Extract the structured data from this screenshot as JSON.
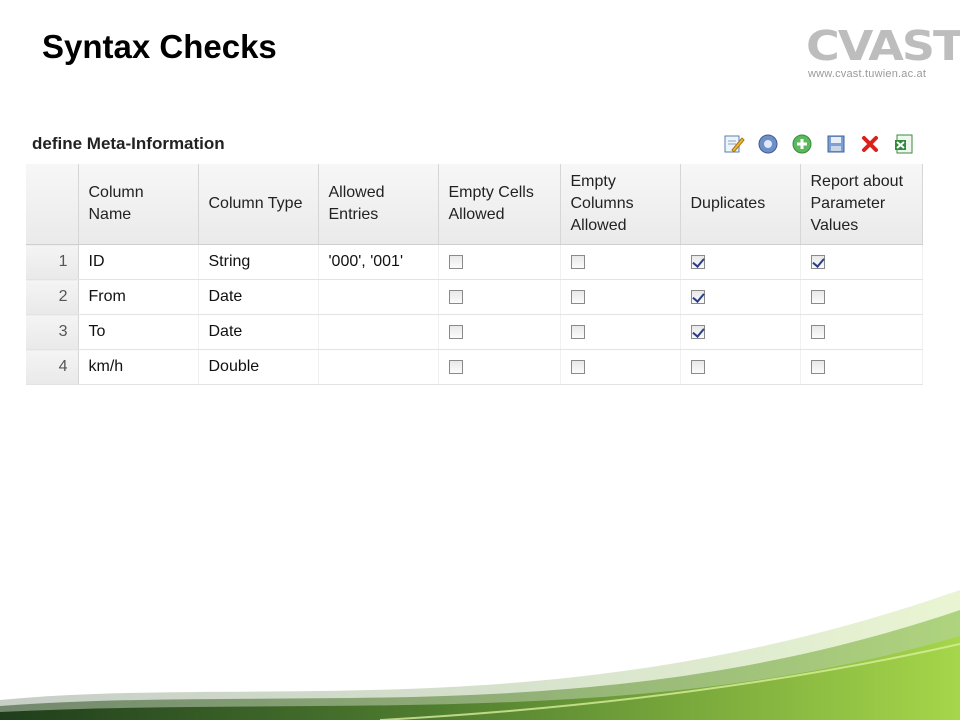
{
  "slide": {
    "title": "Syntax Checks",
    "logo_text": "CVAST",
    "logo_url": "www.cvast.tuwien.ac.at"
  },
  "panel": {
    "title": "define Meta-Information",
    "toolbar": [
      "edit-icon",
      "info-icon",
      "add-icon",
      "save-icon",
      "delete-icon",
      "excel-export-icon"
    ]
  },
  "columns": [
    "Column Name",
    "Column Type",
    "Allowed Entries",
    "Empty Cells Allowed",
    "Empty Columns Allowed",
    "Duplicates",
    "Report about Parameter Values"
  ],
  "rows": [
    {
      "num": "1",
      "name": "ID",
      "type": "String",
      "allowed": "'000', '001'",
      "empty_cells": false,
      "empty_columns": false,
      "duplicates": true,
      "report": true
    },
    {
      "num": "2",
      "name": "From",
      "type": "Date",
      "allowed": "",
      "empty_cells": false,
      "empty_columns": false,
      "duplicates": true,
      "report": false
    },
    {
      "num": "3",
      "name": "To",
      "type": "Date",
      "allowed": "",
      "empty_cells": false,
      "empty_columns": false,
      "duplicates": true,
      "report": false
    },
    {
      "num": "4",
      "name": "km/h",
      "type": "Double",
      "allowed": "",
      "empty_cells": false,
      "empty_columns": false,
      "duplicates": false,
      "report": false
    }
  ],
  "colors": {
    "wave_green": "#8cc63f",
    "wave_dark": "#2f5a2a"
  }
}
